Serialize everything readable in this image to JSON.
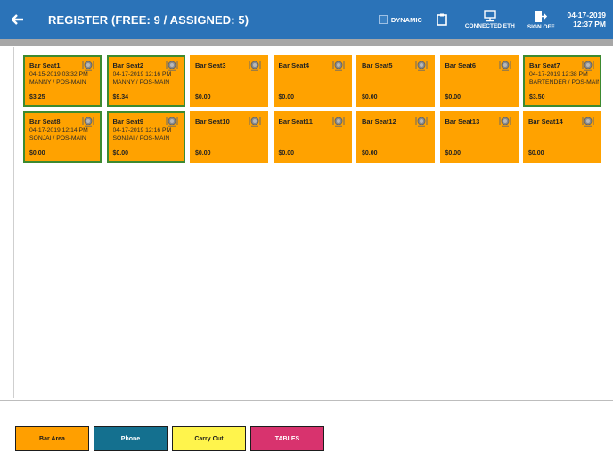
{
  "header": {
    "title": "REGISTER (FREE: 9 / ASSIGNED: 5)",
    "dynamic_label": "DYNAMIC",
    "connection_label": "CONNECTED ETH",
    "signoff_label": "SIGN OFF",
    "date": "04-17-2019",
    "time": "12:37 PM"
  },
  "seats": [
    {
      "name": "Bar Seat1",
      "date": "04-15-2019 03:32 PM",
      "who": "MANNY / POS-MAIN",
      "amount": "$3.25",
      "assigned": true
    },
    {
      "name": "Bar Seat2",
      "date": "04-17-2019 12:16 PM",
      "who": "MANNY / POS-MAIN",
      "amount": "$9.34",
      "assigned": true
    },
    {
      "name": "Bar Seat3",
      "date": "",
      "who": "",
      "amount": "$0.00",
      "assigned": false
    },
    {
      "name": "Bar Seat4",
      "date": "",
      "who": "",
      "amount": "$0.00",
      "assigned": false
    },
    {
      "name": "Bar Seat5",
      "date": "",
      "who": "",
      "amount": "$0.00",
      "assigned": false
    },
    {
      "name": "Bar Seat6",
      "date": "",
      "who": "",
      "amount": "$0.00",
      "assigned": false
    },
    {
      "name": "Bar Seat7",
      "date": "04-17-2019 12:38 PM",
      "who": "BARTENDER / POS-MAIN",
      "amount": "$3.50",
      "assigned": true
    },
    {
      "name": "Bar Seat8",
      "date": "04-17-2019 12:14 PM",
      "who": "SONJAI / POS-MAIN",
      "amount": "$0.00",
      "assigned": true
    },
    {
      "name": "Bar Seat9",
      "date": "04-17-2019 12:16 PM",
      "who": "SONJAI / POS-MAIN",
      "amount": "$0.00",
      "assigned": true
    },
    {
      "name": "Bar Seat10",
      "date": "",
      "who": "",
      "amount": "$0.00",
      "assigned": false
    },
    {
      "name": "Bar Seat11",
      "date": "",
      "who": "",
      "amount": "$0.00",
      "assigned": false
    },
    {
      "name": "Bar Seat12",
      "date": "",
      "who": "",
      "amount": "$0.00",
      "assigned": false
    },
    {
      "name": "Bar Seat13",
      "date": "",
      "who": "",
      "amount": "$0.00",
      "assigned": false
    },
    {
      "name": "Bar Seat14",
      "date": "",
      "who": "",
      "amount": "$0.00",
      "assigned": false
    }
  ],
  "areas": [
    {
      "label": "Bar Area",
      "color": "#ff9f00",
      "text_color": "#1b1b1b"
    },
    {
      "label": "Phone",
      "color": "#14708f",
      "text_color": "#ffffff"
    },
    {
      "label": "Carry Out",
      "color": "#fff44c",
      "text_color": "#1b1b1b"
    },
    {
      "label": "TABLES",
      "color": "#d8336e",
      "text_color": "#ffffff"
    }
  ],
  "colors": {
    "header_bg": "#2b73b8",
    "seat_bg": "#ffa200",
    "assigned_border": "#3d8a30"
  },
  "icons": {
    "back": "arrow-left-icon",
    "dynamic": "checkbox-icon",
    "clipboard": "clipboard-icon",
    "connection": "monitor-icon",
    "signoff": "exit-door-icon",
    "seat": "plate-fork-knife-icon"
  }
}
